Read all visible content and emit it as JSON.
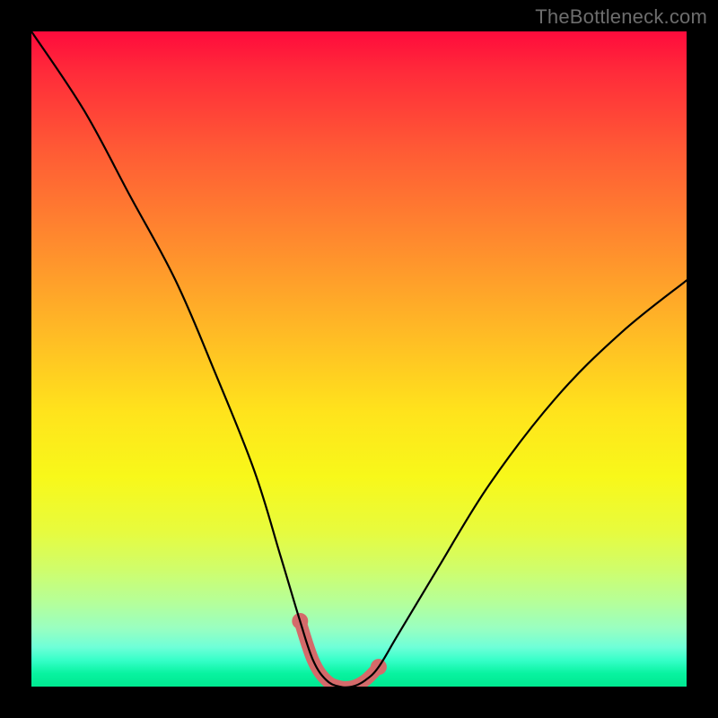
{
  "watermark": "TheBottleneck.com",
  "chart_data": {
    "type": "line",
    "title": "",
    "xlabel": "",
    "ylabel": "",
    "xlim": [
      0,
      100
    ],
    "ylim": [
      0,
      100
    ],
    "grid": false,
    "legend": false,
    "description": "V-shaped bottleneck curve on rainbow gradient background; no axis ticks or numeric labels are visible.",
    "series": [
      {
        "name": "bottleneck-curve",
        "x": [
          0,
          8,
          15,
          22,
          28,
          34,
          38,
          41,
          43,
          45,
          47,
          49,
          51,
          53,
          56,
          62,
          70,
          80,
          90,
          100
        ],
        "y": [
          100,
          88,
          75,
          62,
          48,
          33,
          20,
          10,
          4,
          1,
          0,
          0,
          1,
          3,
          8,
          18,
          31,
          44,
          54,
          62
        ],
        "color": "#000000"
      },
      {
        "name": "valley-highlight",
        "x": [
          41,
          43,
          45,
          47,
          49,
          51,
          53
        ],
        "y": [
          10,
          4,
          1,
          0,
          0,
          1,
          3
        ],
        "color": "#d46a6a",
        "stroke_width": 14,
        "endpoints": "round-dots"
      }
    ]
  }
}
